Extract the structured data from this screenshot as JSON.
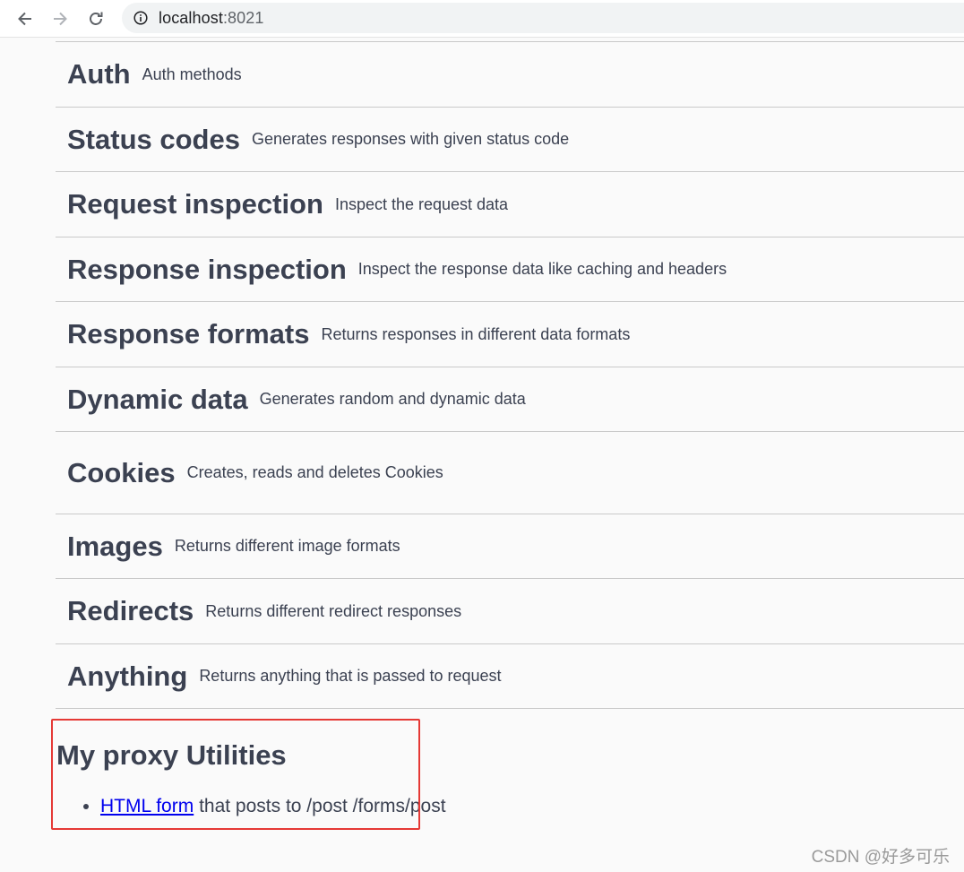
{
  "browser": {
    "url_host": "localhost",
    "url_port": ":8021"
  },
  "tags": [
    {
      "title": "Auth",
      "description": "Auth methods"
    },
    {
      "title": "Status codes",
      "description": "Generates responses with given status code"
    },
    {
      "title": "Request inspection",
      "description": "Inspect the request data"
    },
    {
      "title": "Response inspection",
      "description": "Inspect the response data like caching and headers"
    },
    {
      "title": "Response formats",
      "description": "Returns responses in different data formats"
    },
    {
      "title": "Dynamic data",
      "description": "Generates random and dynamic data"
    },
    {
      "title": "Cookies",
      "description": "Creates, reads and deletes Cookies"
    },
    {
      "title": "Images",
      "description": "Returns different image formats"
    },
    {
      "title": "Redirects",
      "description": "Returns different redirect responses"
    },
    {
      "title": "Anything",
      "description": "Returns anything that is passed to request"
    }
  ],
  "proxy": {
    "title": "My proxy Utilities",
    "link_text": "HTML form",
    "rest_text": " that posts to /post /forms/post"
  },
  "watermark": "CSDN @好多可乐",
  "colors": {
    "text": "#3b4151",
    "link": "#0000ee",
    "highlight": "#e53935"
  }
}
